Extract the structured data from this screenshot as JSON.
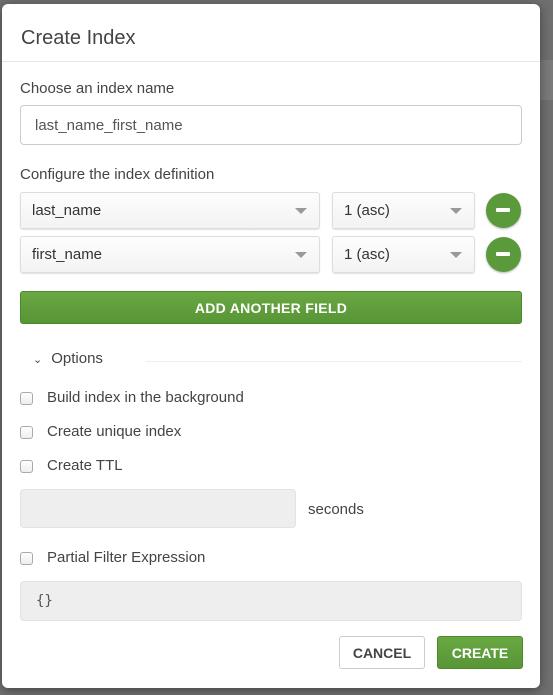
{
  "modal": {
    "title": "Create Index",
    "name_label": "Choose an index name",
    "name_value": "last_name_first_name",
    "definition_label": "Configure the index definition",
    "fields": [
      {
        "field": "last_name",
        "order": "1 (asc)"
      },
      {
        "field": "first_name",
        "order": "1 (asc)"
      }
    ],
    "add_field_label": "ADD ANOTHER FIELD",
    "options_label": "Options",
    "options": [
      {
        "label": "Build index in the background",
        "checked": false
      },
      {
        "label": "Create unique index",
        "checked": false
      },
      {
        "label": "Create TTL",
        "checked": false
      }
    ],
    "ttl_value": "",
    "ttl_unit": "seconds",
    "partial_label": "Partial Filter Expression",
    "partial_checked": false,
    "partial_value": "{}",
    "cancel_label": "CANCEL",
    "create_label": "CREATE"
  },
  "colors": {
    "accent": "#5a9a3a"
  }
}
